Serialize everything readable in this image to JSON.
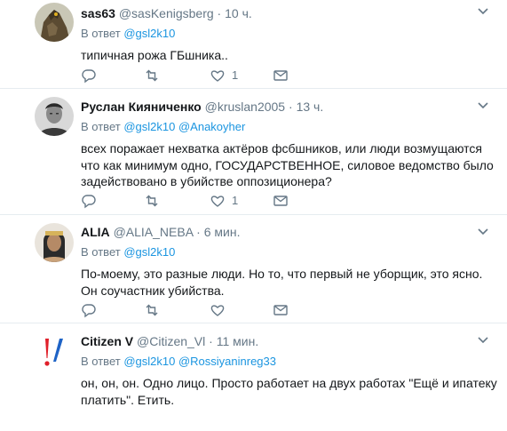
{
  "reply_prefix": "В ответ",
  "tweets": [
    {
      "name": "sas63",
      "handle": "@sasKenigsberg",
      "sep": "·",
      "time": "10 ч.",
      "mentions": [
        "@gsl2k10"
      ],
      "text": "типичная рожа ГБшника..",
      "like_count": "1"
    },
    {
      "name": "Руслан Кияниченко",
      "handle": "@kruslan2005",
      "sep": "·",
      "time": "13 ч.",
      "mentions": [
        "@gsl2k10",
        "@Anakoyher"
      ],
      "text": "всех поражает нехватка актёров фсбшников, или люди возмущаются что как минимум одно, ГОСУДАРСТВЕННОЕ, силовое ведомство было задействовано в убийстве оппозиционера?",
      "like_count": "1"
    },
    {
      "name": "ALIA",
      "handle": "@ALIA_NEBA",
      "sep": "·",
      "time": "6 мин.",
      "mentions": [
        "@gsl2k10"
      ],
      "text": "По-моему, это разные люди. Но то, что первый не уборщик, это ясно. Он соучастник убийства.",
      "like_count": ""
    },
    {
      "name": "Citizen V",
      "handle": "@Citizen_Vl",
      "sep": "·",
      "time": "11 мин.",
      "mentions": [
        "@gsl2k10",
        "@Rossiyaninreg33"
      ],
      "text": "он, он, он. Одно лицо. Просто работает на двух работах \"Ещё и ипатеку платить\". Етить.",
      "like_count": ""
    }
  ],
  "icons": {
    "reply": "reply-icon",
    "retweet": "retweet-icon",
    "like": "heart-icon",
    "message": "envelope-icon",
    "more": "chevron-down-icon"
  },
  "colors": {
    "link": "#1b95e0",
    "meta": "#657786",
    "divider": "#e6ecf0"
  }
}
